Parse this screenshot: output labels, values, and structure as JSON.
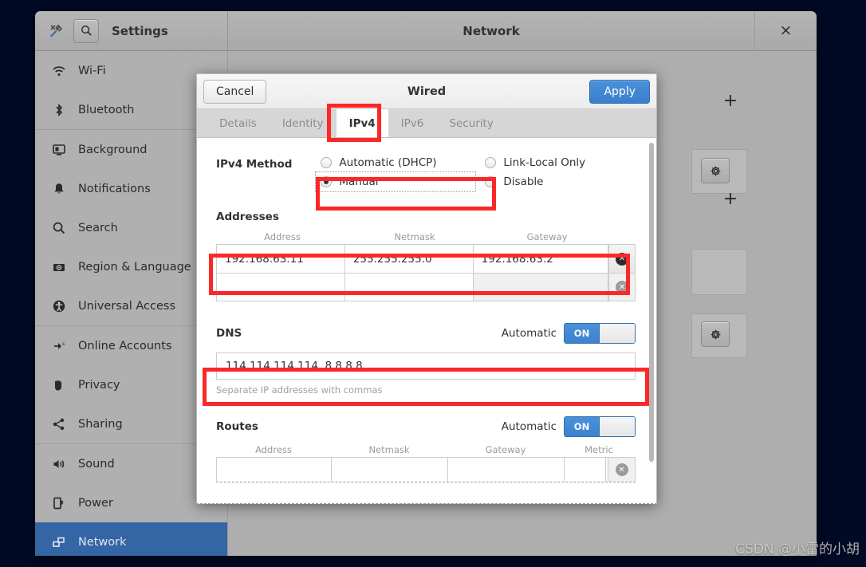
{
  "window": {
    "app_title": "Settings",
    "page_title": "Network",
    "close_label": "×",
    "tools_icon": "tools-icon",
    "search_icon": "search-icon"
  },
  "sidebar": {
    "items": [
      {
        "label": "Wi-Fi",
        "icon": "wifi-icon",
        "selected": false
      },
      {
        "label": "Bluetooth",
        "icon": "bluetooth-icon",
        "selected": false
      },
      {
        "label": "Background",
        "icon": "background-icon",
        "selected": false
      },
      {
        "label": "Notifications",
        "icon": "bell-icon",
        "selected": false
      },
      {
        "label": "Search",
        "icon": "search-icon",
        "selected": false
      },
      {
        "label": "Region & Language",
        "icon": "region-language-icon",
        "selected": false
      },
      {
        "label": "Universal Access",
        "icon": "accessibility-icon",
        "selected": false
      },
      {
        "label": "Online Accounts",
        "icon": "online-accounts-icon",
        "selected": false
      },
      {
        "label": "Privacy",
        "icon": "hand-icon",
        "selected": false
      },
      {
        "label": "Sharing",
        "icon": "share-icon",
        "selected": false
      },
      {
        "label": "Sound",
        "icon": "speaker-icon",
        "selected": false
      },
      {
        "label": "Power",
        "icon": "power-icon",
        "selected": false
      },
      {
        "label": "Network",
        "icon": "network-icon",
        "selected": true
      }
    ]
  },
  "background_panel": {
    "add_label": "+",
    "gear_icon": "gear-icon"
  },
  "dialog": {
    "title": "Wired",
    "cancel_label": "Cancel",
    "apply_label": "Apply",
    "tabs": [
      {
        "label": "Details",
        "active": false
      },
      {
        "label": "Identity",
        "active": false
      },
      {
        "label": "IPv4",
        "active": true
      },
      {
        "label": "IPv6",
        "active": false
      },
      {
        "label": "Security",
        "active": false
      }
    ],
    "ipv4_method": {
      "label": "IPv4 Method",
      "options": [
        {
          "label": "Automatic (DHCP)",
          "selected": false
        },
        {
          "label": "Link-Local Only",
          "selected": false
        },
        {
          "label": "Manual",
          "selected": true
        },
        {
          "label": "Disable",
          "selected": false
        }
      ]
    },
    "addresses": {
      "title": "Addresses",
      "columns": [
        "Address",
        "Netmask",
        "Gateway"
      ],
      "rows": [
        {
          "address": "192.168.63.11",
          "netmask": "255.255.255.0",
          "gateway": "192.168.63.2",
          "delete_icon": "delete-circle-icon"
        },
        {
          "address": "",
          "netmask": "",
          "gateway": "",
          "delete_icon": "delete-circle-icon"
        }
      ]
    },
    "dns": {
      "title": "DNS",
      "automatic_label": "Automatic",
      "toggle_state": "ON",
      "value": "114.114.114.114, 8.8.8.8",
      "hint": "Separate IP addresses with commas"
    },
    "routes": {
      "title": "Routes",
      "automatic_label": "Automatic",
      "toggle_state": "ON",
      "columns": [
        "Address",
        "Netmask",
        "Gateway",
        "Metric"
      ],
      "rows": [
        {
          "address": "",
          "netmask": "",
          "gateway": "",
          "metric": "",
          "delete_icon": "delete-circle-icon"
        }
      ]
    }
  },
  "annotations": {
    "color": "#fc2828",
    "boxes": [
      "ipv4-tab",
      "manual-option",
      "address-row",
      "dns-input"
    ]
  },
  "watermark": {
    "text": "CSDN @小雷的小胡"
  },
  "colors": {
    "accent_blue": "#4a90d9",
    "selection_blue": "#3465a4",
    "desktop": "#000a24",
    "chrome_gray": "#aeaeae",
    "annotation_red": "#fc2828"
  }
}
